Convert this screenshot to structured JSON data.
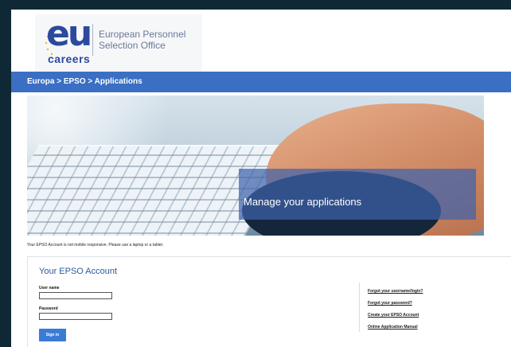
{
  "logo": {
    "brand": "eu",
    "sub": "careers",
    "org_line1": "European Personnel",
    "org_line2": "Selection Office"
  },
  "breadcrumb": {
    "text": "Europa > EPSO > Applications"
  },
  "hero": {
    "caption": "Manage your applications"
  },
  "notice": "Your EPSO Account is not mobile responsive. Please use a laptop or a tablet.",
  "account": {
    "title": "Your EPSO Account",
    "username_label": "User name",
    "username_value": "",
    "password_label": "Password",
    "password_value": "",
    "signin_label": "Sign in",
    "links": [
      "Forgot your username/login?",
      "Forgot your password?",
      "Create your EPSO Account",
      "Online Application Manual"
    ]
  },
  "colors": {
    "brand_blue": "#2c4a9c",
    "nav_blue": "#3a6fc4",
    "button_blue": "#3a7bd5",
    "frame_dark": "#0f2836"
  }
}
